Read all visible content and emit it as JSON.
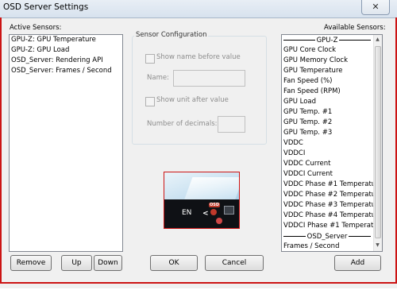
{
  "window": {
    "title": "OSD Server Settings",
    "close_glyph": "✕"
  },
  "active_sensors": {
    "label": "Active Sensors:",
    "items": [
      "GPU-Z: GPU Temperature",
      "GPU-Z: GPU Load",
      "OSD_Server: Rendering API",
      "OSD_Server: Frames / Second"
    ]
  },
  "sensor_config": {
    "label": "Sensor Configuration",
    "show_name_label": "Show name before value",
    "name_label": "Name:",
    "name_value": "",
    "show_unit_label": "Show unit after value",
    "decimals_label": "Number of decimals:",
    "decimals_value": ""
  },
  "available_sensors": {
    "label": "Available Sensors:",
    "group1": "GPU-Z",
    "items": [
      "GPU Core Clock",
      "GPU Memory Clock",
      "GPU Temperature",
      "Fan Speed (%)",
      "Fan Speed (RPM)",
      "GPU Load",
      "GPU Temp. #1",
      "GPU Temp. #2",
      "GPU Temp. #3",
      "VDDC",
      "VDDCI",
      "VDDC Current",
      "VDDCI Current",
      "VDDC Phase #1 Temperatur",
      "VDDC Phase #2 Temperatur",
      "VDDC Phase #3 Temperatur",
      "VDDC Phase #4 Temperatur",
      "VDDCI Phase #1 Temperatu"
    ],
    "group2": "OSD_Server",
    "partial_item": "Frames / Second"
  },
  "preview": {
    "lang": "EN",
    "chevron": "<",
    "osd_badge": "OSD"
  },
  "buttons": {
    "remove": "Remove",
    "up": "Up",
    "down": "Down",
    "ok": "OK",
    "cancel": "Cancel",
    "add": "Add"
  },
  "colors": {
    "accent_red": "#cc1414",
    "taskbar": "#0f1115"
  }
}
